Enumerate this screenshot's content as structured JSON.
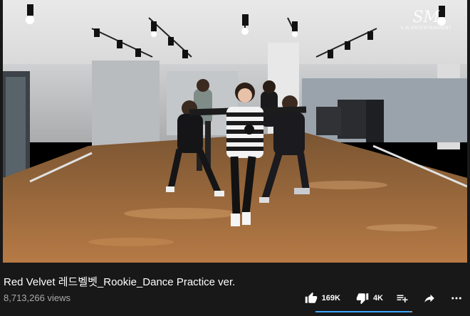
{
  "video": {
    "watermark_logo": "SM",
    "watermark_sub": "S.M.ENTERTAINMENT",
    "title": "Red Velvet 레드벨벳_Rookie_Dance Practice ver.",
    "views": "8,713,266 views",
    "like_ratio": 0.97
  },
  "actions": {
    "like_count": "169K",
    "dislike_count": "4K",
    "icons": [
      "thumbs-up-icon",
      "thumbs-down-icon",
      "add-to-playlist-icon",
      "share-icon",
      "more-icon"
    ]
  },
  "colors": {
    "background": "#181818",
    "secondary_text": "#aaaaaa",
    "rating_bar": "#3ea6ff"
  }
}
